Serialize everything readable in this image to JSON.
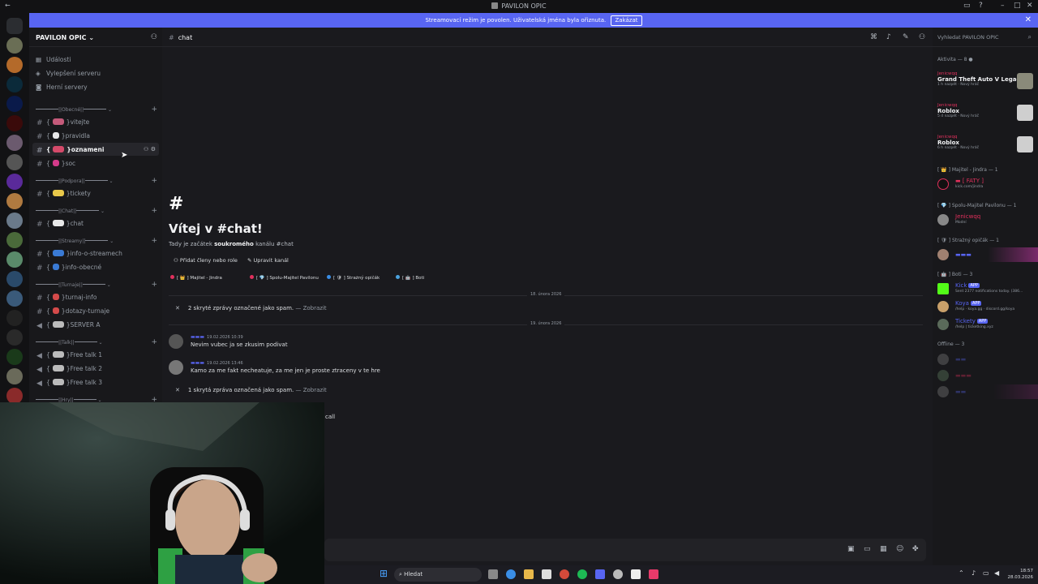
{
  "window": {
    "title": "PAVILON OPIC"
  },
  "banner": {
    "text": "Streamovací režim je povolen. Uživatelská jména byla ořiznuta.",
    "button": "Zakázat"
  },
  "server": {
    "name": "PAVILON OPIC"
  },
  "sidebar": {
    "top_items": [
      "Události",
      "Vylepšení serveru",
      "Herní servery"
    ],
    "categories": [
      "||Obecné||",
      "||Podpora||",
      "||Chat||",
      "||Streamy||",
      "||Turnaje||",
      "||Talk||",
      "||Hry||"
    ],
    "channels": [
      "vitejte",
      "pravidla",
      "oznameni",
      "soc",
      "tickety",
      "chat",
      "info-o-streamech",
      "info-obecné",
      "turnaj-info",
      "dotazy-turnaje",
      "SERVER A",
      "Free talk 1",
      "Free talk 2",
      "Free talk 3"
    ]
  },
  "channel": {
    "name": "chat",
    "welcome_title": "Vítej v #chat!",
    "welcome_sub_1": "Tady je začátek ",
    "welcome_sub_bold": "soukromého",
    "welcome_sub_2": " kanálu #chat",
    "btn_add_members": "Přidat členy nebo role",
    "btn_edit": "Upravit kanál",
    "roles": [
      "Majitel - Jindra",
      "Spolu-Majitel Pavilonu",
      "Strażný opičák",
      "Boti"
    ],
    "role_colors": [
      "#e0305c",
      "#e0305c",
      "#3a8ee6",
      "#4aa3df"
    ]
  },
  "messages": {
    "date1": "18. února 2026",
    "spam1": "2 skryté zprávy označené jako spam.",
    "show": "— Zobrazit",
    "date2": "19. února 2026",
    "m1_time": "19.02.2026 10:39",
    "m1_text": "Nevim vubec ja se zkusim podivat",
    "m2_time": "19.02.2026 13:46",
    "m2_text": "Kamo za me fakt necheatuje, za me jen je proste ztraceny v te hre",
    "spam2": "1 skrytá zpráva označená jako spam.",
    "tail": "call"
  },
  "members": {
    "search": "Vyhledat PAVILON OPIC",
    "activity_header": "Aktivita — 8",
    "activities": [
      {
        "user": "Jenicwqq",
        "game": "Grand Theft Auto V Legacy",
        "sub": "1 h nazpět",
        "tag": "Nový hráč"
      },
      {
        "user": "Jenicwqq",
        "game": "Roblox",
        "sub": "5 d nazpět",
        "tag": "Nový hráč"
      },
      {
        "user": "Jenicwqq",
        "game": "Roblox",
        "sub": "6 h nazpět",
        "tag": "Nový hráč"
      }
    ],
    "group1": "Majitel - Jindra — 1",
    "m_owner_sub": "kick.com/jindra",
    "group2": "Spolu-Majitel Pavilonu — 1",
    "m_coowner_name": "Jenicwqq",
    "m_coowner_sub": "Modní",
    "group3": "Strażný opičák — 1",
    "group4": "Boti — 3",
    "bots": [
      {
        "name": "Kick",
        "sub": "Sent 2377 notifications today. (386..."
      },
      {
        "name": "Koya",
        "sub": "/help · koya.gg · discord.gg/koya"
      },
      {
        "name": "Tickety",
        "sub": "/help | ticketking.xyz"
      }
    ],
    "app_badge": "APP",
    "offline": "Offline — 3"
  },
  "taskbar": {
    "search": "Hledat",
    "time": "18:57",
    "date": "28.03.2026"
  }
}
